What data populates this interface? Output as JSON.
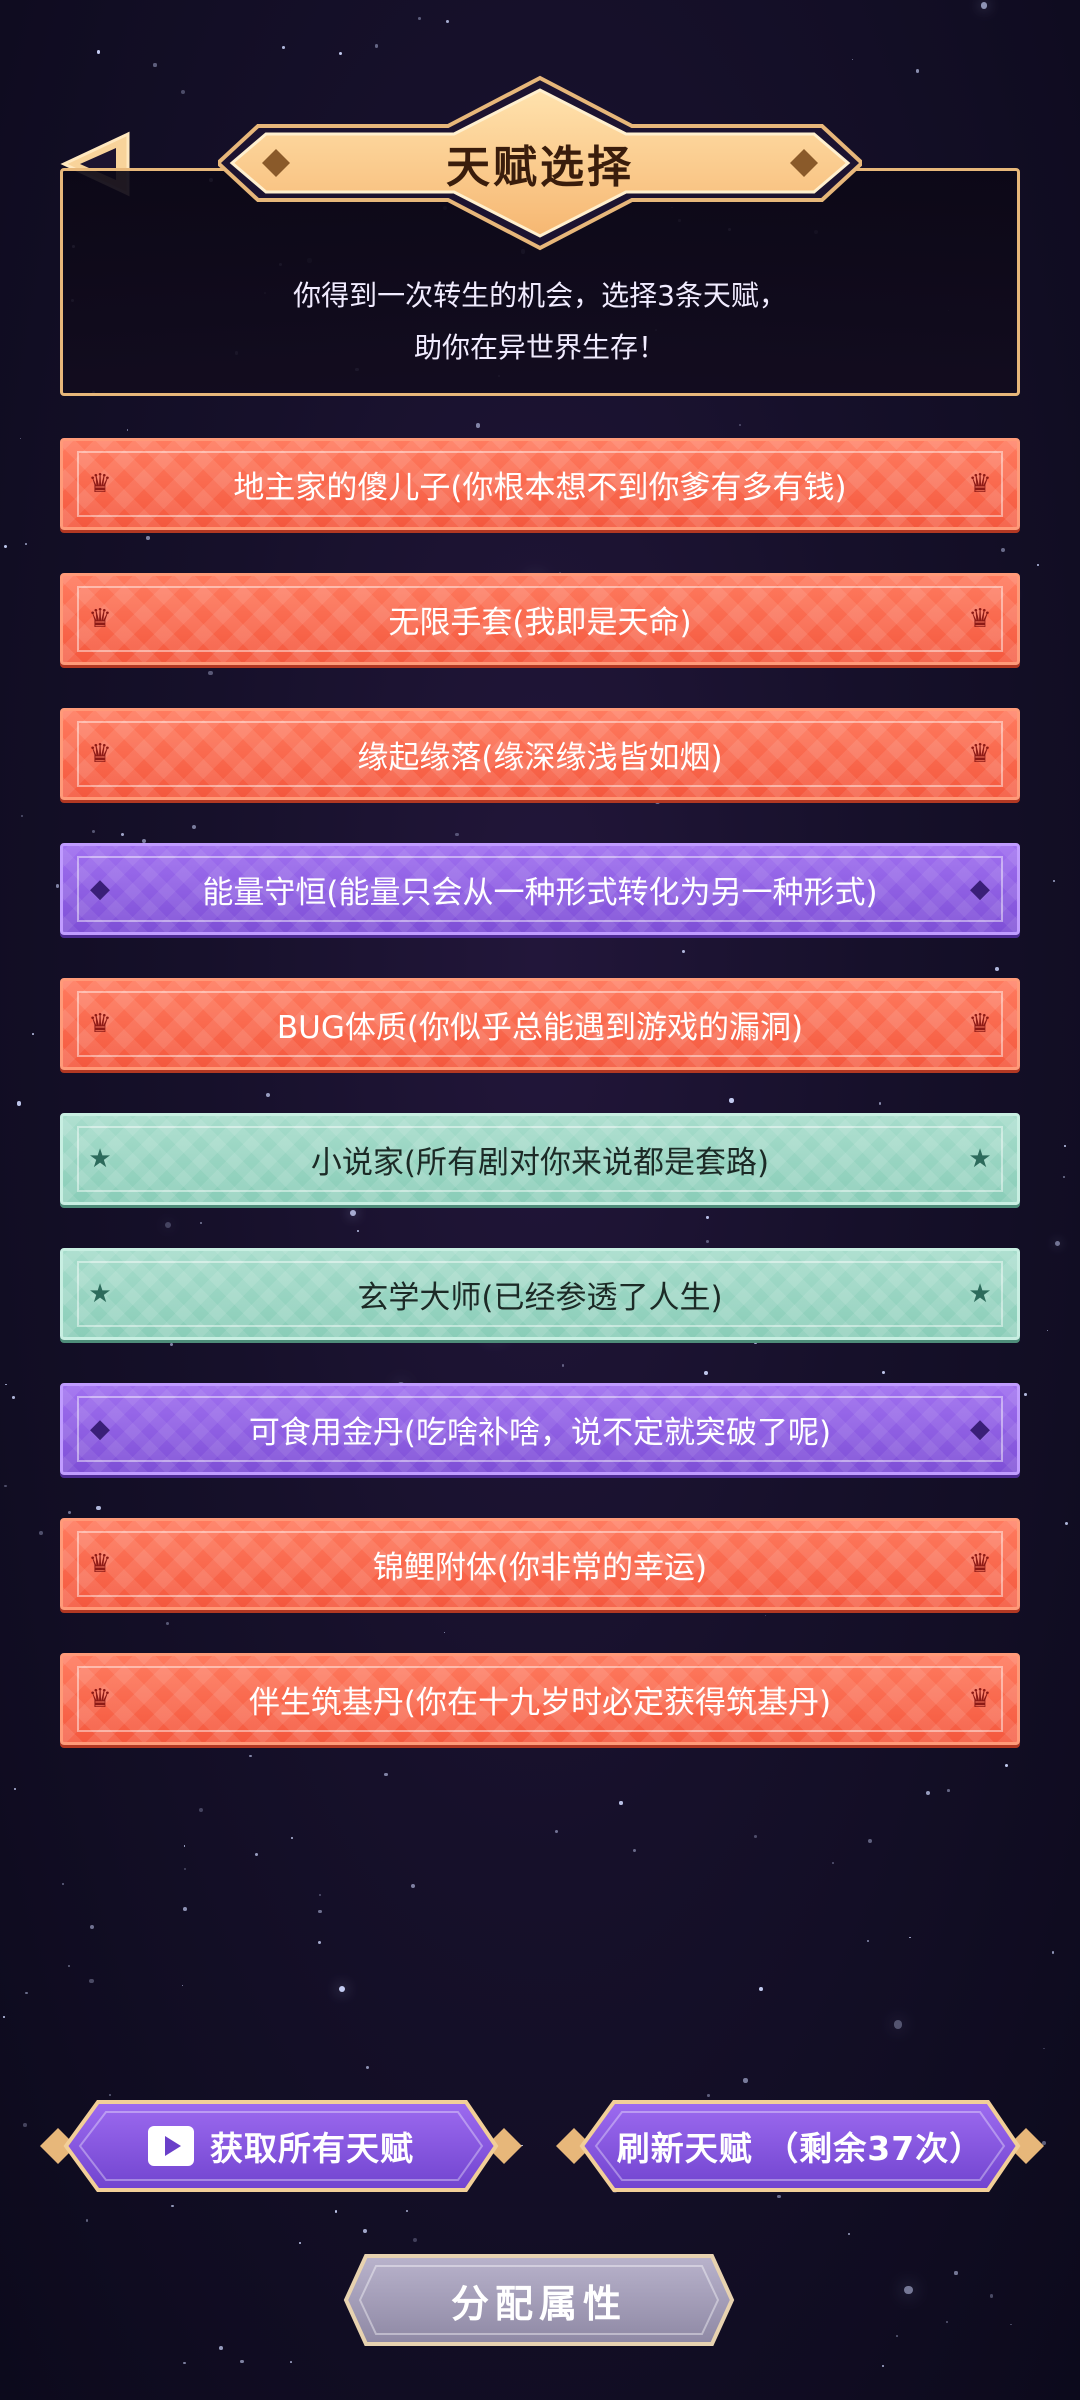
{
  "header": {
    "title": "天赋选择",
    "subtitle_line1": "你得到一次转生的机会，选择3条天赋，",
    "subtitle_line2": "助你在异世界生存！"
  },
  "colors": {
    "orange": "#f4583e",
    "purple": "#8a5ae0",
    "green": "#94d3bf",
    "gold": "#e7b77a",
    "background": "#16102a"
  },
  "talents": [
    {
      "label": "地主家的傻儿子(你根本想不到你爹有多有钱)",
      "rarity": "orange",
      "icon": "crown-icon"
    },
    {
      "label": "无限手套(我即是天命)",
      "rarity": "orange",
      "icon": "crown-icon"
    },
    {
      "label": "缘起缘落(缘深缘浅皆如烟)",
      "rarity": "orange",
      "icon": "crown-icon"
    },
    {
      "label": "能量守恒(能量只会从一种形式转化为另一种形式)",
      "rarity": "purple",
      "icon": "diamond-icon"
    },
    {
      "label": "BUG体质(你似乎总能遇到游戏的漏洞)",
      "rarity": "orange",
      "icon": "crown-icon"
    },
    {
      "label": "小说家(所有剧对你来说都是套路)",
      "rarity": "green",
      "icon": "star-icon"
    },
    {
      "label": "玄学大师(已经参透了人生)",
      "rarity": "green",
      "icon": "star-icon"
    },
    {
      "label": "可食用金丹(吃啥补啥，说不定就突破了呢)",
      "rarity": "purple",
      "icon": "diamond-icon"
    },
    {
      "label": "锦鲤附体(你非常的幸运)",
      "rarity": "orange",
      "icon": "crown-icon"
    },
    {
      "label": "伴生筑基丹(你在十九岁时必定获得筑基丹)",
      "rarity": "orange",
      "icon": "crown-icon"
    }
  ],
  "buttons": {
    "get_all": "获取所有天赋",
    "refresh": "刷新天赋 （剩余37次）",
    "assign": "分配属性"
  }
}
